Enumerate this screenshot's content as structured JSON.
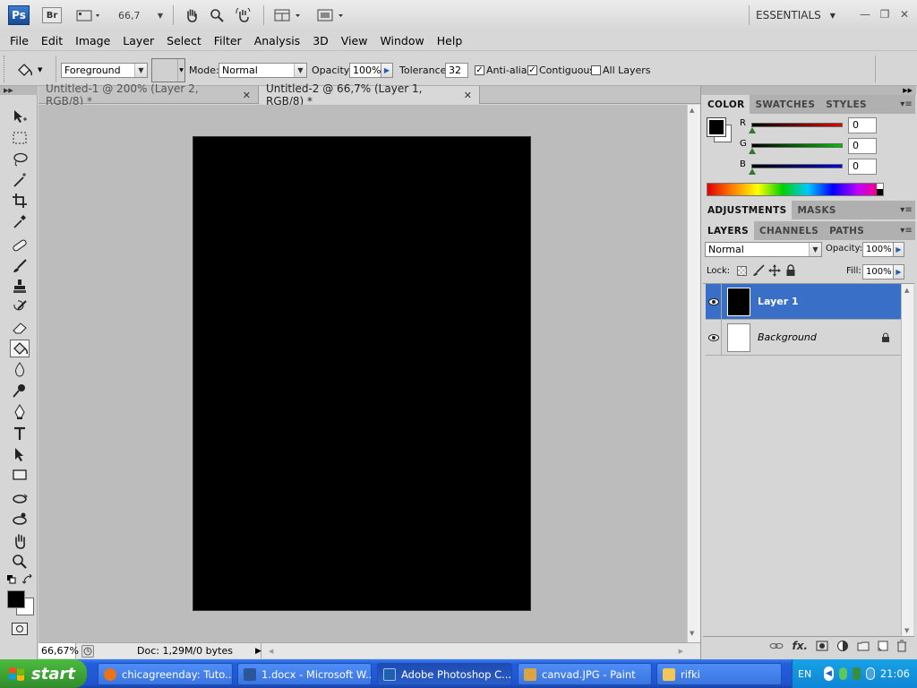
{
  "appbar": {
    "logo": "Ps",
    "bridge": "Br",
    "zoom": "66,7",
    "workspace": "ESSENTIALS"
  },
  "menu": [
    "File",
    "Edit",
    "Image",
    "Layer",
    "Select",
    "Filter",
    "Analysis",
    "3D",
    "View",
    "Window",
    "Help"
  ],
  "options": {
    "fill_source": "Foreground",
    "mode_label": "Mode:",
    "mode_value": "Normal",
    "opacity_label": "Opacity:",
    "opacity_value": "100%",
    "tolerance_label": "Tolerance:",
    "tolerance_value": "32",
    "antialias_label": "Anti-alias",
    "antialias_checked": true,
    "contiguous_label": "Contiguous",
    "contiguous_checked": true,
    "alllayers_label": "All Layers",
    "alllayers_checked": false
  },
  "tools": [
    "move-icon",
    "marquee-icon",
    "lasso-icon",
    "magic-wand-icon",
    "crop-icon",
    "eyedropper-icon",
    "healing-brush-icon",
    "brush-icon",
    "clone-stamp-icon",
    "history-brush-icon",
    "eraser-icon",
    "paint-bucket-icon",
    "blur-icon",
    "dodge-icon",
    "pen-icon",
    "type-icon",
    "path-select-icon",
    "shape-icon",
    "3d-rotate-icon",
    "3d-orbit-icon",
    "hand-icon",
    "zoom-icon"
  ],
  "tabs": [
    {
      "label": "Untitled-1 @ 200% (Layer 2, RGB/8) *",
      "active": false
    },
    {
      "label": "Untitled-2 @ 66,7% (Layer 1, RGB/8) *",
      "active": true
    }
  ],
  "status": {
    "zoom": "66,67%",
    "doc": "Doc: 1,29M/0 bytes"
  },
  "color_panel": {
    "tabs": [
      "COLOR",
      "SWATCHES",
      "STYLES"
    ],
    "channels": [
      {
        "name": "R",
        "value": "0",
        "color": "#e00000"
      },
      {
        "name": "G",
        "value": "0",
        "color": "#00c000"
      },
      {
        "name": "B",
        "value": "0",
        "color": "#0000e0"
      }
    ],
    "foreground": "#000000",
    "background": "#ffffff"
  },
  "adjust_panel": {
    "tabs": [
      "ADJUSTMENTS",
      "MASKS"
    ]
  },
  "layers_panel": {
    "tabs": [
      "LAYERS",
      "CHANNELS",
      "PATHS"
    ],
    "blend_mode": "Normal",
    "opacity_label": "Opacity:",
    "opacity_value": "100%",
    "lock_label": "Lock:",
    "fill_label": "Fill:",
    "fill_value": "100%",
    "layers": [
      {
        "name": "Layer 1",
        "selected": true,
        "thumb": "#000000"
      },
      {
        "name": "Background",
        "selected": false,
        "thumb": "#ffffff"
      }
    ]
  },
  "taskbar": {
    "start": "start",
    "tasks": [
      {
        "label": "chicagreenday: Tuto...",
        "icon": "#e8731b"
      },
      {
        "label": "1.docx - Microsoft W...",
        "icon": "#2b579a"
      },
      {
        "label": "Adobe Photoshop C...",
        "icon": "#1f5fb0",
        "active": true
      },
      {
        "label": "canvad.JPG - Paint",
        "icon": "#d9a441"
      },
      {
        "label": "rifki",
        "icon": "#f1c75a"
      }
    ],
    "lang": "EN",
    "clock": "21:06"
  }
}
